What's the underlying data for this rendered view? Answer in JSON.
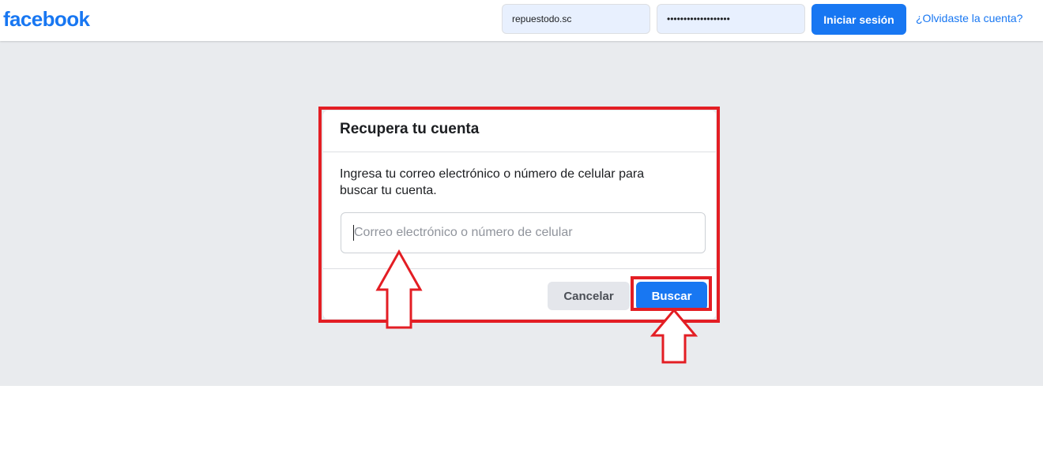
{
  "header": {
    "logo": "facebook",
    "email_value": "repuestodo.sc",
    "password_value": "•••••••••••••••••••",
    "login_button": "Iniciar sesión",
    "forgot_link": "¿Olvidaste la cuenta?"
  },
  "dialog": {
    "title": "Recupera tu cuenta",
    "description": "Ingresa tu correo electrónico o número de celular para buscar tu cuenta.",
    "input_placeholder": "Correo electrónico o número de celular",
    "input_value": "",
    "cancel_button": "Cancelar",
    "search_button": "Buscar"
  },
  "colors": {
    "brand": "#1877f2",
    "annotation": "#e31e24",
    "background": "#e9ebee"
  },
  "annotations": {
    "icons": [
      "up-arrow-icon",
      "up-arrow-icon"
    ]
  }
}
